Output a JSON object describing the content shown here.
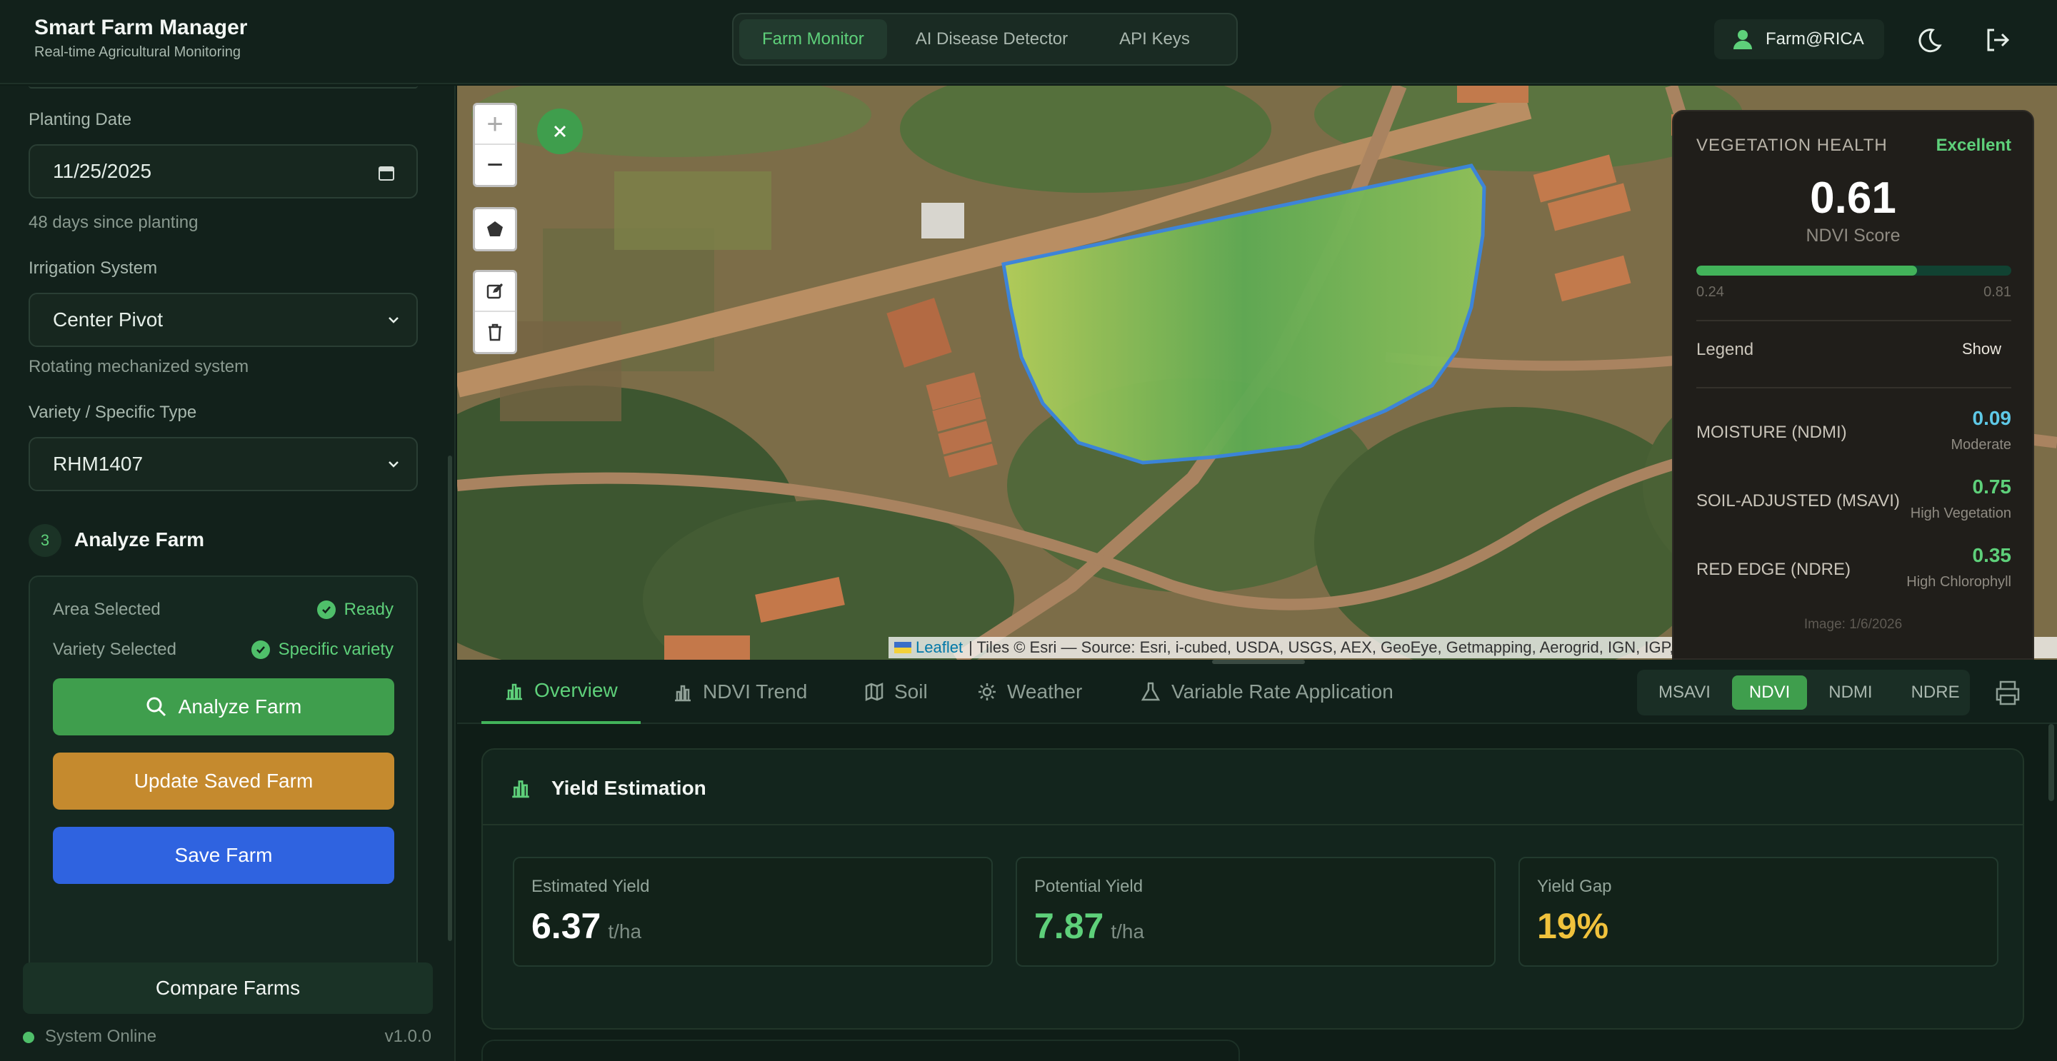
{
  "header": {
    "title": "Smart Farm Manager",
    "subtitle": "Real-time Agricultural Monitoring",
    "nav": [
      "Farm Monitor",
      "AI Disease Detector",
      "API Keys"
    ],
    "user": "Farm@RICA"
  },
  "sidebar": {
    "planting_date_label": "Planting Date",
    "planting_date_value": "11/25/2025",
    "days_since": "48 days since planting",
    "irrigation_label": "Irrigation System",
    "irrigation_value": "Center Pivot",
    "irrigation_hint": "Rotating mechanized system",
    "variety_label": "Variety / Specific Type",
    "variety_value": "RHM1407",
    "step_number": "3",
    "step_title": "Analyze Farm",
    "area_label": "Area Selected",
    "area_status": "Ready",
    "variety_sel_label": "Variety Selected",
    "variety_sel_status": "Specific variety",
    "analyze_btn": "Analyze Farm",
    "update_btn": "Update Saved Farm",
    "save_btn": "Save Farm",
    "compare_btn": "Compare Farms",
    "status": "System Online",
    "version": "v1.0.0"
  },
  "map": {
    "attribution_link": "Leaflet",
    "attribution_text": "| Tiles © Esri — Source: Esri, i-cubed, USDA, USGS, AEX, GeoEye, Getmapping, Aerogrid, IGN, IGP, UPR-EGP, and the GIS User Community"
  },
  "vegetation": {
    "heading": "VEGETATION HEALTH",
    "rating": "Excellent",
    "score": "0.61",
    "score_label": "NDVI Score",
    "score_fraction": 0.7,
    "range_min": "0.24",
    "range_max": "0.81",
    "legend_label": "Legend",
    "legend_toggle": "Show",
    "indices": [
      {
        "name": "MOISTURE (NDMI)",
        "value": "0.09",
        "desc": "Moderate",
        "color": "#5ec8e6"
      },
      {
        "name": "SOIL-ADJUSTED (MSAVI)",
        "value": "0.75",
        "desc": "High Vegetation",
        "color": "#5ed07a"
      },
      {
        "name": "RED EDGE (NDRE)",
        "value": "0.35",
        "desc": "High Chlorophyll",
        "color": "#5ed07a"
      }
    ],
    "image_date": "Image: 1/6/2026"
  },
  "tabs": [
    "Overview",
    "NDVI Trend",
    "Soil",
    "Weather",
    "Variable Rate Application"
  ],
  "index_switch": [
    "MSAVI",
    "NDVI",
    "NDMI",
    "NDRE"
  ],
  "yield": {
    "title": "Yield Estimation",
    "metrics": [
      {
        "label": "Estimated Yield",
        "value": "6.37",
        "unit": "t/ha",
        "color": "#ffffff"
      },
      {
        "label": "Potential Yield",
        "value": "7.87",
        "unit": "t/ha",
        "color": "#5ed07a"
      },
      {
        "label": "Yield Gap",
        "value": "19%",
        "unit": "",
        "color": "#f0c23c"
      }
    ]
  },
  "colors": {
    "accent": "#42b35a",
    "orange": "#c58a2e",
    "blue": "#2f63e0"
  }
}
